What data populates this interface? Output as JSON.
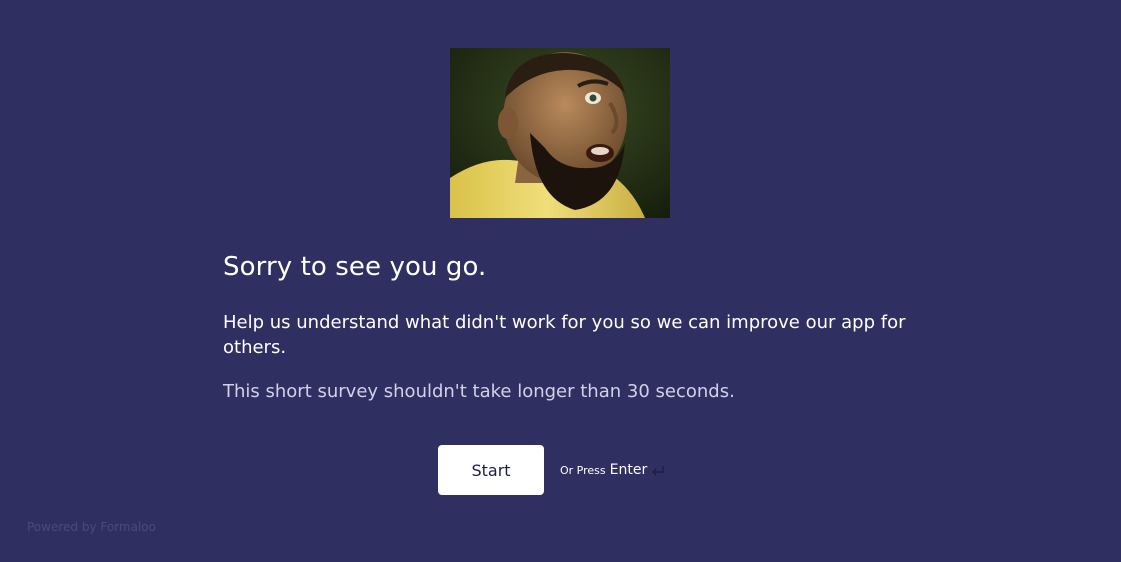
{
  "hero": {
    "image_name": "bearded-man-shocked-gif"
  },
  "content": {
    "title": "Sorry to see you go.",
    "description": "Help us understand what didn't work for you so we can improve our app for others.",
    "note": "This short survey shouldn't take longer than 30 seconds."
  },
  "actions": {
    "start_label": "Start",
    "or_press": "Or Press",
    "enter_key": "Enter",
    "return_icon": "return-arrow-icon"
  },
  "footer": {
    "powered_by": "Powered by Formaloo"
  },
  "colors": {
    "background": "#302f62",
    "button_bg": "#ffffff",
    "button_text": "#1e1d44",
    "text": "#ffffff",
    "muted_text": "#d2d1e6",
    "footer_text": "#4b4a7c"
  }
}
